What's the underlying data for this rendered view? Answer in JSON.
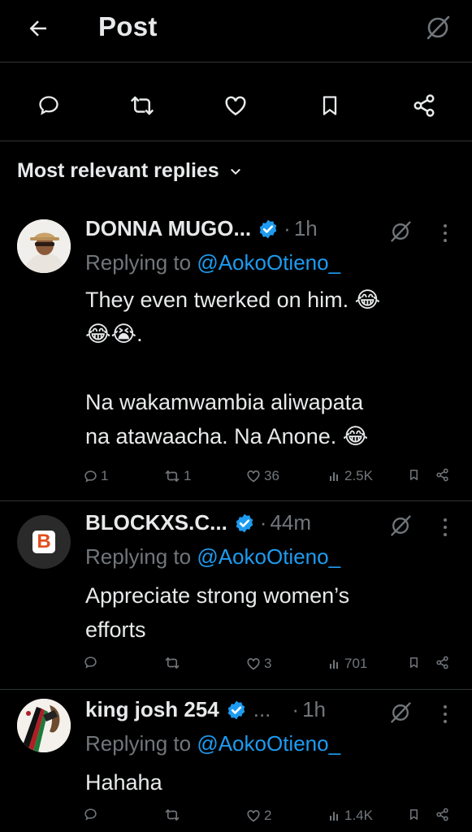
{
  "header": {
    "title": "Post",
    "back_icon": "arrow-left-icon",
    "grok_icon": "grok-icon"
  },
  "post_actions": [
    {
      "name": "reply-icon"
    },
    {
      "name": "repost-icon"
    },
    {
      "name": "like-icon"
    },
    {
      "name": "bookmark-icon"
    },
    {
      "name": "share-icon"
    }
  ],
  "sort": {
    "label": "Most relevant replies",
    "icon": "chevron-down-icon"
  },
  "colors": {
    "background": "#000000",
    "text": "#e7e9ea",
    "muted": "#71767b",
    "link": "#1d9bf0",
    "verified": "#1d9bf0",
    "divider": "#2f3336"
  },
  "replies": [
    {
      "name": "DONNA MUGO...",
      "time": "1h",
      "replying_prefix": "Replying to ",
      "replying_handle": "@AokoOtieno_",
      "text_line1": "They even twerked on him. 😂",
      "text_line2": "😂😭.",
      "text_line3": "Na wakamwambia aliwapata",
      "text_line4": "na atawaacha. Na Anone. 😂",
      "stats": {
        "replies": "1",
        "reposts": "1",
        "likes": "36",
        "views": "2.5K"
      }
    },
    {
      "name": "BLOCKXS.C...",
      "time": "44m",
      "avatar_letter": "B",
      "replying_prefix": "Replying to ",
      "replying_handle": "@AokoOtieno_",
      "text_line1": "Appreciate strong women’s",
      "text_line2": "efforts",
      "stats": {
        "replies": "",
        "reposts": "",
        "likes": "3",
        "views": "701"
      }
    },
    {
      "name": "king josh 254",
      "ellipsis": "...",
      "time": "1h",
      "replying_prefix": "Replying to ",
      "replying_handle": "@AokoOtieno_",
      "text_line1": "Hahaha",
      "stats": {
        "replies": "",
        "reposts": "",
        "likes": "2",
        "views": "1.4K"
      }
    }
  ]
}
